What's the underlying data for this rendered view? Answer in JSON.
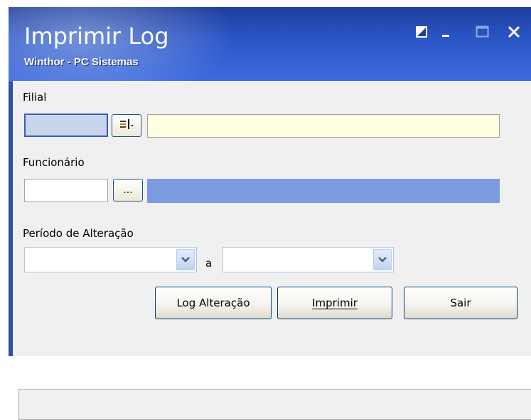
{
  "window": {
    "title": "Imprimir Log",
    "subtitle": "Winthor - PC Sistemas"
  },
  "titlebar_buttons": {
    "restore_icon": "restore-icon",
    "minimize_icon": "minimize-icon",
    "maximize_icon": "maximize-icon",
    "close_icon": "close-icon"
  },
  "form": {
    "filial_label": "Filial",
    "filial_code": "",
    "filial_lookup_icon": "list-lookup-icon",
    "filial_name": "",
    "funcionario_label": "Funcionário",
    "funcionario_code": "",
    "funcionario_lookup_label": "...",
    "funcionario_name": "",
    "periodo_label": "Período de Alteração",
    "date_from": "",
    "date_separator": "a",
    "date_to": ""
  },
  "buttons": {
    "log_label": "Log Alteração",
    "imprimir_label": "Imprimir",
    "sair_label": "Sair"
  },
  "status": {
    "text": ""
  },
  "colors": {
    "title_bar": "#2a55c4",
    "filial_code_bg": "#c8d4ec",
    "filial_name_bg": "#ffffe1",
    "funcionario_name_bg": "#7b9be0"
  }
}
